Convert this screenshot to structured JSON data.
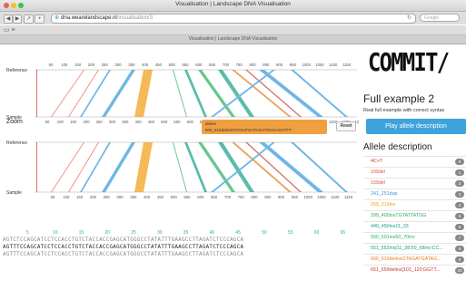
{
  "window": {
    "title": "Visualisation | Landscape DNA Visualisation"
  },
  "toolbar": {
    "back": "◀",
    "forward": "▶",
    "url_domain": "dna.wearelandscape.nl",
    "url_path": "/visualisation/3",
    "search_placeholder": "Google"
  },
  "tab": {
    "title": "Visualisation | Landscape DNA Visualisation"
  },
  "visualisation": {
    "reference_label": "Reference",
    "sample_label": "Sample",
    "zoom_label": "Zoom",
    "reset_label": "Reset",
    "tooltip_title": "deline",
    "tooltip_value": "600_610delinsGTAGATGATAGATGAGAGATTT",
    "axis_ticks": [
      "50",
      "100",
      "150",
      "200",
      "250",
      "300",
      "350",
      "400",
      "450",
      "500",
      "550",
      "600",
      "650",
      "700",
      "750",
      "800",
      "850",
      "900",
      "950",
      "1000",
      "1050",
      "1100",
      "1150",
      "1200",
      "1250"
    ],
    "sequence_numbers": [
      "5",
      "10",
      "15",
      "20",
      "25",
      "30",
      "35",
      "40",
      "45",
      "50",
      "55",
      "60",
      "65"
    ],
    "sequence_reference": "AGTCTCCAGCATCCTCCACCTGTCTACCACCGAGCATGGGCCTATATTTGAAGCCTTAGATCTCCCAGCA",
    "sequence_sample": "AGTTTCCAGCATCCTCCACCTGTCTACCACCGAGCATGGGCCTATATTTGAAGCCTTAGATCTCCCAGCA",
    "sequence_reference_2": "AGTTTCCAGCATCCTCCACCTGTCTACCACCGAGCATGGGCCTATATTTGAAGCCTTAGATCTCCCAGCA"
  },
  "sidebar": {
    "logo": "COMMIT/",
    "heading": "Full example 2",
    "subtitle": "Real full example with correct syntax",
    "play_button": "Play allele description",
    "allele_heading": "Allele description",
    "alleles": [
      {
        "label": "4C>T",
        "badge": "0",
        "color": "#c0392b"
      },
      {
        "label": "109del",
        "badge": "1",
        "color": "#e74c3c"
      },
      {
        "label": "159del",
        "badge": "2",
        "color": "#e74c3c"
      },
      {
        "label": "241_251dup",
        "badge": "3",
        "color": "#3498db"
      },
      {
        "label": "259_319inv",
        "badge": "4",
        "color": "#f39c12"
      },
      {
        "label": "399_400insTGTATTATGG",
        "badge": "5",
        "color": "#27ae60"
      },
      {
        "label": "449_450ins11_33",
        "badge": "6",
        "color": "#16a085"
      },
      {
        "label": "500_501ins50_70inv",
        "badge": "7",
        "color": "#27ae60"
      },
      {
        "label": "551_552ins[11_38;50_68inv;CC...",
        "badge": "8",
        "color": "#16a085"
      },
      {
        "label": "600_610delinsGTAGATGATAG...",
        "badge": "9",
        "color": "#e67e22"
      },
      {
        "label": "651_659delins[101_120;GGTT...",
        "badge": "10",
        "color": "#c0392b"
      }
    ]
  },
  "colors": {
    "accent": "#3ca3db",
    "teal": "#3aa9a0",
    "orange": "#f0a040"
  }
}
